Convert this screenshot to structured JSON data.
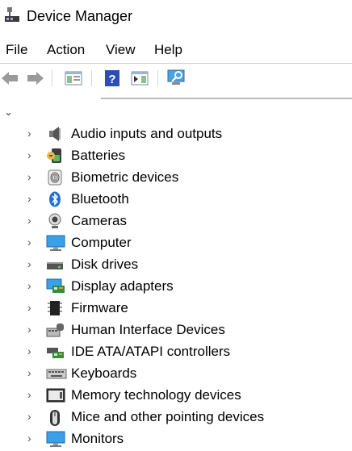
{
  "window": {
    "title": "Device Manager"
  },
  "menu": {
    "items": [
      "File",
      "Action",
      "View",
      "Help"
    ]
  },
  "toolbar": {
    "buttons": [
      "back-arrow",
      "forward-arrow",
      "show-hide-console-tree",
      "help",
      "properties-pane",
      "scan-hardware"
    ]
  },
  "tree": {
    "categories": [
      {
        "label": "Audio inputs and outputs",
        "icon": "speaker-icon"
      },
      {
        "label": "Batteries",
        "icon": "battery-icon"
      },
      {
        "label": "Biometric devices",
        "icon": "fingerprint-icon"
      },
      {
        "label": "Bluetooth",
        "icon": "bluetooth-icon"
      },
      {
        "label": "Cameras",
        "icon": "webcam-icon"
      },
      {
        "label": "Computer",
        "icon": "monitor-icon"
      },
      {
        "label": "Disk drives",
        "icon": "disk-drive-icon"
      },
      {
        "label": "Display adapters",
        "icon": "display-adapter-icon"
      },
      {
        "label": "Firmware",
        "icon": "chip-icon"
      },
      {
        "label": "Human Interface Devices",
        "icon": "hid-icon"
      },
      {
        "label": "IDE ATA/ATAPI controllers",
        "icon": "ide-controller-icon"
      },
      {
        "label": "Keyboards",
        "icon": "keyboard-icon"
      },
      {
        "label": "Memory technology devices",
        "icon": "memory-card-icon"
      },
      {
        "label": "Mice and other pointing devices",
        "icon": "mouse-icon"
      },
      {
        "label": "Monitors",
        "icon": "monitor-icon"
      }
    ]
  }
}
